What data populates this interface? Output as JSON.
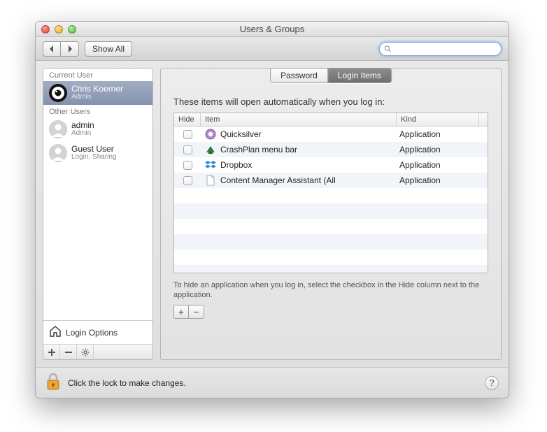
{
  "window": {
    "title": "Users & Groups"
  },
  "toolbar": {
    "show_all": "Show All",
    "search_placeholder": ""
  },
  "sidebar": {
    "current_label": "Current User",
    "other_label": "Other Users",
    "current": {
      "name": "Chris Koerner",
      "role": "Admin"
    },
    "others": [
      {
        "name": "admin",
        "role": "Admin"
      },
      {
        "name": "Guest User",
        "role": "Login, Sharing"
      }
    ],
    "login_options": "Login Options"
  },
  "tabs": {
    "password": "Password",
    "login_items": "Login Items"
  },
  "main": {
    "heading": "These items will open automatically when you log in:",
    "columns": {
      "hide": "Hide",
      "item": "Item",
      "kind": "Kind"
    },
    "items": [
      {
        "name": "Quicksilver",
        "kind": "Application",
        "icon": "quicksilver-icon"
      },
      {
        "name": "CrashPlan menu bar",
        "kind": "Application",
        "icon": "crashplan-icon"
      },
      {
        "name": "Dropbox",
        "kind": "Application",
        "icon": "dropbox-icon"
      },
      {
        "name": "Content Manager Assistant (All",
        "kind": "Application",
        "icon": "document-icon"
      }
    ],
    "hint": "To hide an application when you log in, select the checkbox in the Hide column next to the application."
  },
  "footer": {
    "lock_text": "Click the lock to make changes."
  }
}
